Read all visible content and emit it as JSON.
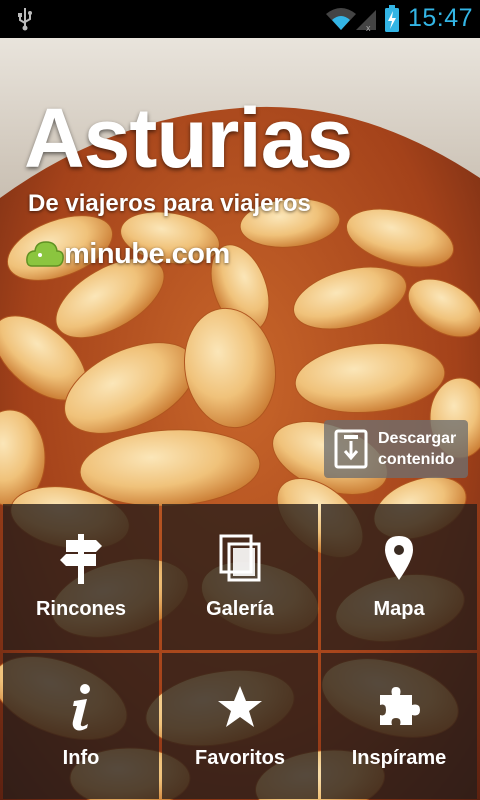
{
  "status_bar": {
    "time": "15:47",
    "icons": [
      "usb-icon",
      "wifi-icon",
      "signal-icon",
      "battery-charging-icon"
    ],
    "accent_color": "#33b5e5"
  },
  "hero": {
    "title": "Asturias",
    "subtitle": "De viajeros para viajeros",
    "brand": "minube.com"
  },
  "download": {
    "label_line1": "Descargar",
    "label_line2": "contenido",
    "icon": "download-icon"
  },
  "menu": [
    {
      "label": "Rincones",
      "icon": "signpost-icon"
    },
    {
      "label": "Galería",
      "icon": "gallery-icon"
    },
    {
      "label": "Mapa",
      "icon": "map-pin-icon"
    },
    {
      "label": "Info",
      "icon": "info-icon"
    },
    {
      "label": "Favoritos",
      "icon": "star-icon"
    },
    {
      "label": "Inspírame",
      "icon": "puzzle-icon"
    }
  ]
}
